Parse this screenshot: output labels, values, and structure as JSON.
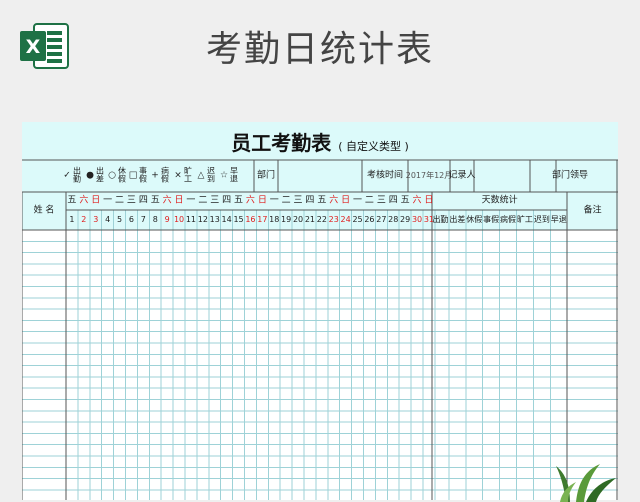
{
  "header": {
    "app_icon": "excel-icon",
    "logo_letter": "X",
    "title": "考勤日统计表"
  },
  "sheet": {
    "title": "员工考勤表",
    "subtitle": "( 自定义类型 )",
    "legend": [
      {
        "symbol": "✓",
        "label": "出勤"
      },
      {
        "symbol": "●",
        "label": "出差"
      },
      {
        "symbol": "○",
        "label": "休假"
      },
      {
        "symbol": "□",
        "label": "事假"
      },
      {
        "symbol": "+",
        "label": "病假"
      },
      {
        "symbol": "×",
        "label": "旷工"
      },
      {
        "symbol": "△",
        "label": "迟到"
      },
      {
        "symbol": "☆",
        "label": "早退"
      }
    ],
    "info": {
      "department_label": "部门",
      "period_label": "考核时间",
      "period_value": "2017年12月",
      "recorder_label": "记录人",
      "leader_label": "部门领导"
    },
    "name_header": "姓 名",
    "weekdays": [
      "五",
      "六",
      "日",
      "一",
      "二",
      "三",
      "四",
      "五",
      "六",
      "日",
      "一",
      "二",
      "三",
      "四",
      "五",
      "六",
      "日",
      "一",
      "二",
      "三",
      "四",
      "五",
      "六",
      "日",
      "一",
      "二",
      "三",
      "四",
      "五",
      "六",
      "日"
    ],
    "days": [
      1,
      2,
      3,
      4,
      5,
      6,
      7,
      8,
      9,
      10,
      11,
      12,
      13,
      14,
      15,
      16,
      17,
      18,
      19,
      20,
      21,
      22,
      23,
      24,
      25,
      26,
      27,
      28,
      29,
      30,
      31
    ],
    "weekend_color": "#e02020",
    "summary_header": "天数统计",
    "summary_columns": [
      "出勤",
      "出差",
      "休假",
      "事假",
      "病假",
      "旷工",
      "迟到",
      "早退"
    ],
    "remark_header": "备注"
  },
  "colors": {
    "excel_green": "#1e7145",
    "sheet_header_bg": "#dcfafa",
    "grid_cyan": "#9ed2d7",
    "weekend_red": "#e02020"
  }
}
